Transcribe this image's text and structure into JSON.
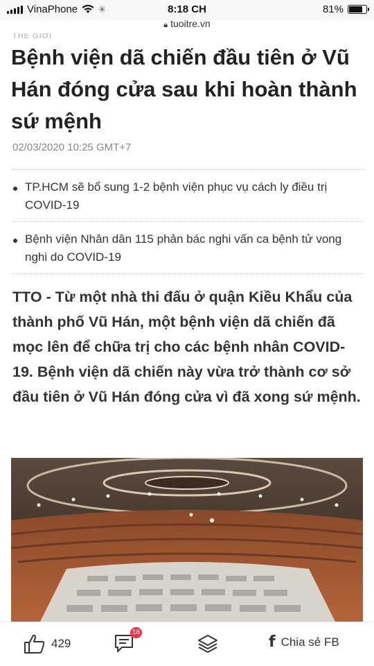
{
  "status_bar": {
    "carrier": "VinaPhone",
    "time": "8:18 CH",
    "battery_percent": "81%",
    "battery_level": 0.81,
    "url": "tuoitre.vn"
  },
  "article": {
    "category": "THẾ GIỚI",
    "title": "Bệnh viện dã chiến đầu tiên ở Vũ Hán đóng cửa sau khi hoàn thành sứ mệnh",
    "date": "02/03/2020 10:25 GMT+7",
    "related": [
      {
        "text": "TP.HCM sẽ bổ sung 1-2 bệnh viện phục vụ cách ly điều trị COVID-19"
      },
      {
        "text": "Bệnh viện Nhân dân 115 phản bác nghi vấn ca bệnh tử vong nghi do COVID-19"
      }
    ],
    "lead": "TTO - Từ một nhà thi đấu ở quận Kiều Khẩu của thành phố Vũ Hán, một bệnh viện dã chiến đã mọc lên để chữa trị cho các bệnh nhân COVID-19. Bệnh viện dã chiến này vừa trở thành cơ sở đầu tiên ở Vũ Hán đóng cửa vì đã xong sứ mệnh."
  },
  "bottom_bar": {
    "like_count": "429",
    "comment_count": "18",
    "share_label": "Chia sẻ FB"
  },
  "icons": {
    "like": "thumbs-up-icon",
    "comment": "comment-icon",
    "layers": "layers-icon",
    "facebook": "facebook-icon"
  },
  "colors": {
    "badge": "#e8384f",
    "text": "#222222",
    "muted": "#888888"
  }
}
